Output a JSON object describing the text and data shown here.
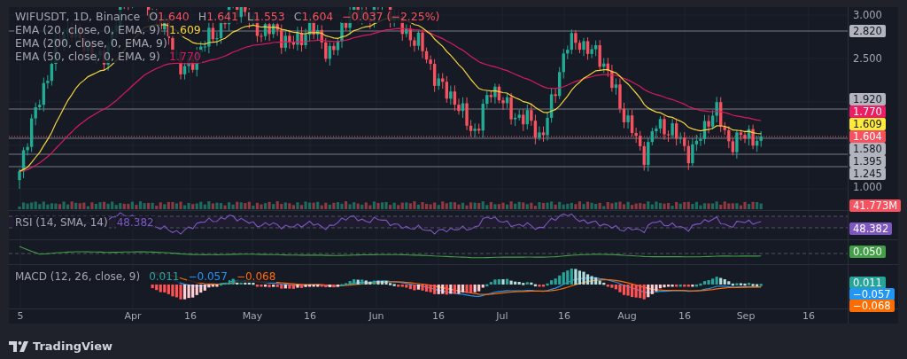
{
  "legend": {
    "symbol": "WIFUSDT, 1D, Binance",
    "ohlc": [
      {
        "label": "O",
        "value": "1.640"
      },
      {
        "label": "H",
        "value": "1.641"
      },
      {
        "label": "L",
        "value": "1.553"
      },
      {
        "label": "C",
        "value": "1.604"
      }
    ],
    "change": "−0.037 (−2.25%)",
    "indicators": [
      {
        "name": "EMA (20, close, 0, EMA, 9)",
        "value": "1.609",
        "color": "#f5d43a"
      },
      {
        "name": "EMA (200, close, 0, EMA, 9)"
      },
      {
        "name": "EMA (50, close, 0, EMA, 9)",
        "value": "1.770",
        "color": "#d81b60"
      }
    ]
  },
  "price_axis": [
    {
      "text": "3.000",
      "kind": "tick"
    },
    {
      "text": "2.820",
      "kind": "level",
      "color": "#b2b5be"
    },
    {
      "text": "2.500",
      "kind": "tick"
    },
    {
      "text": "1.920",
      "kind": "level",
      "color": "#b2b5be"
    },
    {
      "text": "1.770",
      "kind": "ema",
      "color": "#e91e63"
    },
    {
      "text": "1.609",
      "kind": "ema",
      "color": "#ffeb3b"
    },
    {
      "text": "1.604",
      "kind": "price",
      "color": "#f7525f"
    },
    {
      "text": "1.580",
      "kind": "level",
      "color": "#b2b5be"
    },
    {
      "text": "1.395",
      "kind": "level",
      "color": "#b2b5be"
    },
    {
      "text": "1.245",
      "kind": "level",
      "color": "#b2b5be"
    },
    {
      "text": "1.000",
      "kind": "tick"
    }
  ],
  "volume": {
    "axis_label": "41.773M",
    "color": "#f7525f"
  },
  "rsi": {
    "legend": "RSI (14, SMA, 14)",
    "value": "48.382",
    "axis_label": "48.382",
    "color": "#7e57c2"
  },
  "oscillator": {
    "axis_label": "0.050",
    "color": "#43a047"
  },
  "macd": {
    "legend": "MACD (12, 26, close, 9)",
    "values": [
      {
        "value": "0.011",
        "color": "#26a69a"
      },
      {
        "value": "−0.057",
        "color": "#2196f3"
      },
      {
        "value": "−0.068",
        "color": "#ff6d00"
      }
    ],
    "axis_labels": [
      {
        "value": "0.011",
        "color": "#26a69a"
      },
      {
        "value": "−0.057",
        "color": "#2196f3"
      },
      {
        "value": "−0.068",
        "color": "#ff6d00"
      }
    ]
  },
  "time_axis": [
    "5",
    "Apr",
    "16",
    "May",
    "16",
    "Jun",
    "16",
    "Jul",
    "16",
    "Aug",
    "16",
    "Sep",
    "16"
  ],
  "footer": {
    "logo": "TradingView"
  }
}
